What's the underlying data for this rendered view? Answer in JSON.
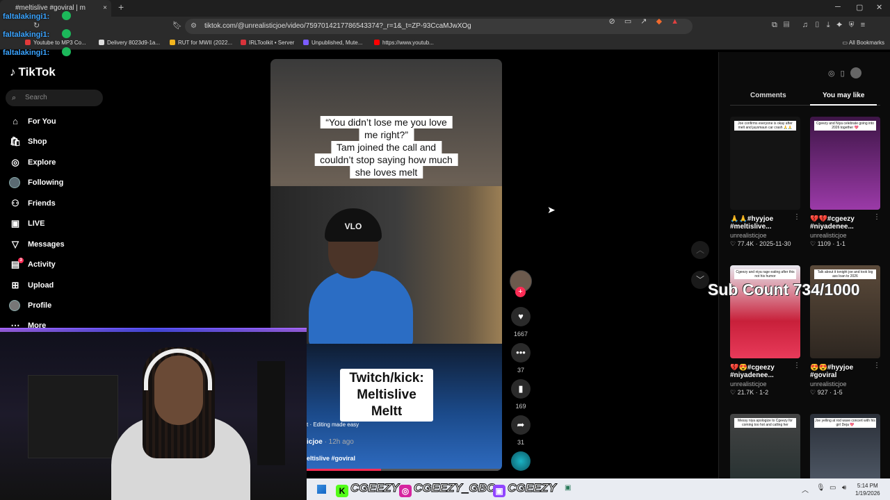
{
  "browser": {
    "tab_title": "#meltislive #goviral | m",
    "url": "tiktok.com/@unrealisticjoe/video/7597014217786543374?_r=1&_t=ZP-93CcaMJwXOg",
    "bookmarks": [
      {
        "label": "Youtube to MP3 Co...",
        "color": "#e23a3a"
      },
      {
        "label": "Delivery 8023d9-1a...",
        "color": "#dddddd"
      },
      {
        "label": "RUT for MWII (2022...",
        "color": "#f2b51e"
      },
      {
        "label": "IRLToolkit • Server",
        "color": "#d9333b"
      },
      {
        "label": "Unpublished, Mute...",
        "color": "#7b5cff"
      },
      {
        "label": "https://www.youtub...",
        "color": "#ff0000"
      }
    ],
    "all_bookmarks": "All Bookmarks"
  },
  "chat": {
    "lines": [
      "faltalakingi1:",
      "faltalakingi1:",
      "faltalakingi1:",
      "faltalakingi1:"
    ]
  },
  "sidebar": {
    "logo": "TikTok",
    "search_placeholder": "Search",
    "items": [
      {
        "label": "For You",
        "icon": "home-icon"
      },
      {
        "label": "Shop",
        "icon": "shop-icon"
      },
      {
        "label": "Explore",
        "icon": "compass-icon"
      },
      {
        "label": "Following",
        "icon": "avatar-icon"
      },
      {
        "label": "Friends",
        "icon": "friends-icon"
      },
      {
        "label": "LIVE",
        "icon": "live-icon"
      },
      {
        "label": "Messages",
        "icon": "send-icon"
      },
      {
        "label": "Activity",
        "icon": "activity-icon",
        "badge": "3"
      },
      {
        "label": "Upload",
        "icon": "plus-box-icon"
      },
      {
        "label": "Profile",
        "icon": "profile-avatar-icon"
      },
      {
        "label": "More",
        "icon": "dots-icon"
      }
    ]
  },
  "video": {
    "caption_lines": [
      "“You didn’t lose me you love",
      "me right?”",
      "Tam joined the call and",
      "couldn’t stop saying how much",
      "she loves melt"
    ],
    "beanie_text": "VLO",
    "twitch_lines": [
      "Twitch/kick:",
      "Meltislive",
      "Meltt"
    ],
    "editing_label": "t · Editing made easy",
    "author": "icjoe",
    "time_ago": "· 12h ago",
    "hashtags": "eltislive #goviral",
    "progress": 0.38
  },
  "actions": {
    "likes": "1667",
    "comments": "37",
    "saves": "169",
    "shares": "31"
  },
  "right_panel": {
    "tabs": [
      "Comments",
      "You may like"
    ],
    "active_tab": "You may like",
    "sub_count": "Sub Count 734/1000",
    "cards": [
      {
        "title": "🙏🙏#hyyjoe",
        "subtitle": "#meltislive...",
        "user": "unrealisticjoe",
        "stats": "♡ 77.4K · 2025-11-30",
        "caption": "Joe confirms everyone is okay after melt and jaysmaun car crash 🙏🙏",
        "thumb_color": "#141414"
      },
      {
        "title": "💔💔#cgeezy",
        "subtitle": "#niyadenee...",
        "user": "unrealisticjoe",
        "stats": "♡ 1109 · 1-1",
        "caption": "Cgeezy and Niya celebrate going into 2026 together 💖",
        "thumb_color": "#6b2a6e"
      },
      {
        "title": "💔😍#cgeezy",
        "subtitle": "#niyadenee...",
        "user": "unrealisticjoe",
        "stats": "♡ 21.7K · 1-2",
        "caption": "Cgeezy and niya rage eating after this not his humor",
        "thumb_color": "#b3263a"
      },
      {
        "title": "😍😍#hyyjoe",
        "subtitle": "#goviral",
        "user": "unrealisticjoe",
        "stats": "♡ 927 · 1-5",
        "caption": "Talk about it tonight joe and took big ass loan to 2026",
        "thumb_color": "#4a3b2c"
      },
      {
        "title": "",
        "subtitle": "",
        "user": "",
        "stats": "",
        "caption": "Messy niya apologize to Cgeezy for coming too hot and calling her",
        "thumb_color": "#3a3a3a"
      },
      {
        "title": "",
        "subtitle": "",
        "user": "",
        "stats": "",
        "caption": "Joe yelling at rod wave concert with his girl Deja 💖",
        "thumb_color": "#2f3640"
      }
    ]
  },
  "overlay": {
    "socials": [
      {
        "handle": "CGEEZY",
        "icon": "kick-icon",
        "color": "#53fc18"
      },
      {
        "handle": "CGEEZY_GBC",
        "icon": "instagram-icon",
        "color": "#d6249f"
      },
      {
        "handle": "CGEEZY",
        "icon": "twitch-icon",
        "color": "#9146ff"
      }
    ]
  },
  "taskbar": {
    "time": "5:14 PM",
    "date": "1/19/2026"
  }
}
